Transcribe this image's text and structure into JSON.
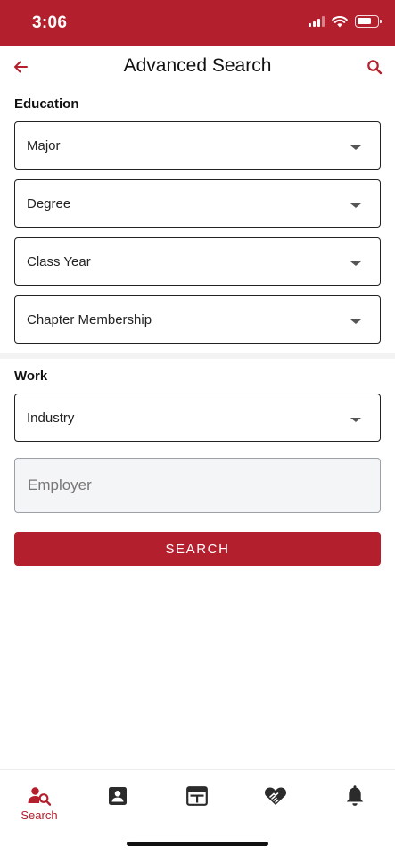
{
  "status_bar": {
    "time": "3:06"
  },
  "header": {
    "title": "Advanced Search",
    "back_icon": "arrow-left-icon",
    "search_icon": "search-icon"
  },
  "education": {
    "heading": "Education",
    "fields": [
      {
        "label": "Major"
      },
      {
        "label": "Degree"
      },
      {
        "label": "Class Year"
      },
      {
        "label": "Chapter Membership"
      }
    ]
  },
  "work": {
    "heading": "Work",
    "industry": {
      "label": "Industry"
    },
    "employer": {
      "placeholder": "Employer",
      "value": ""
    }
  },
  "search_button": {
    "label": "SEARCH"
  },
  "tab_bar": {
    "active": "Search",
    "tabs": [
      {
        "icon": "person-search-icon",
        "label": "Search"
      },
      {
        "icon": "contact-card-icon",
        "label": ""
      },
      {
        "icon": "news-feed-icon",
        "label": ""
      },
      {
        "icon": "handshake-heart-icon",
        "label": ""
      },
      {
        "icon": "bell-icon",
        "label": ""
      }
    ]
  },
  "colors": {
    "brand": "#b41f2d",
    "text": "#111111",
    "field_bg": "#f4f5f6"
  }
}
